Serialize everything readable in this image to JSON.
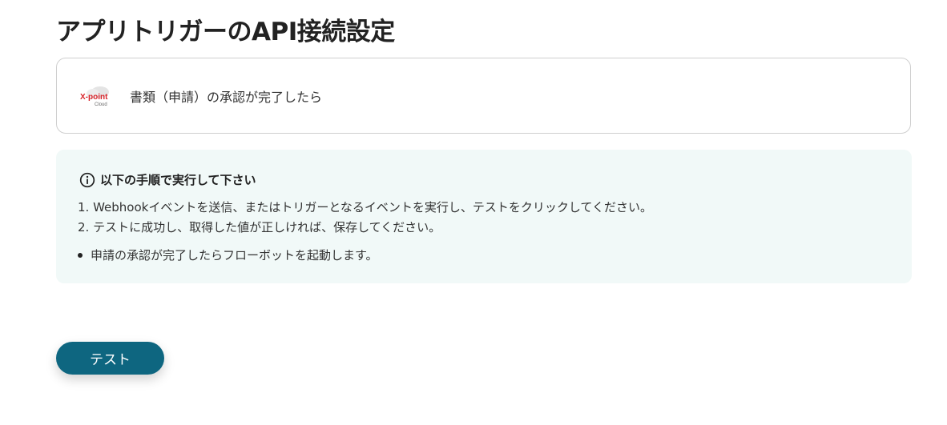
{
  "page": {
    "title": "アプリトリガーのAPI接続設定"
  },
  "trigger": {
    "app_logo_icon": "xpoint-cloud-logo",
    "logo_text": "X-point",
    "logo_subtext": "Cloud",
    "label": "書類（申請）の承認が完了したら"
  },
  "instructions": {
    "icon": "info-circle-icon",
    "heading": "以下の手順で実行して下さい",
    "steps": [
      "1. Webhookイベントを送信、またはトリガーとなるイベントを実行し、テストをクリックしてください。",
      "2. テストに成功し、取得した値が正しければ、保存してください。"
    ],
    "bullets": [
      "申請の承認が完了したらフローボットを起動します。"
    ]
  },
  "actions": {
    "test_label": "テスト"
  },
  "colors": {
    "primary": "#0e6680",
    "info_bg": "#f1f9f8",
    "border": "#cfcfcf",
    "logo_red": "#d9262c"
  }
}
